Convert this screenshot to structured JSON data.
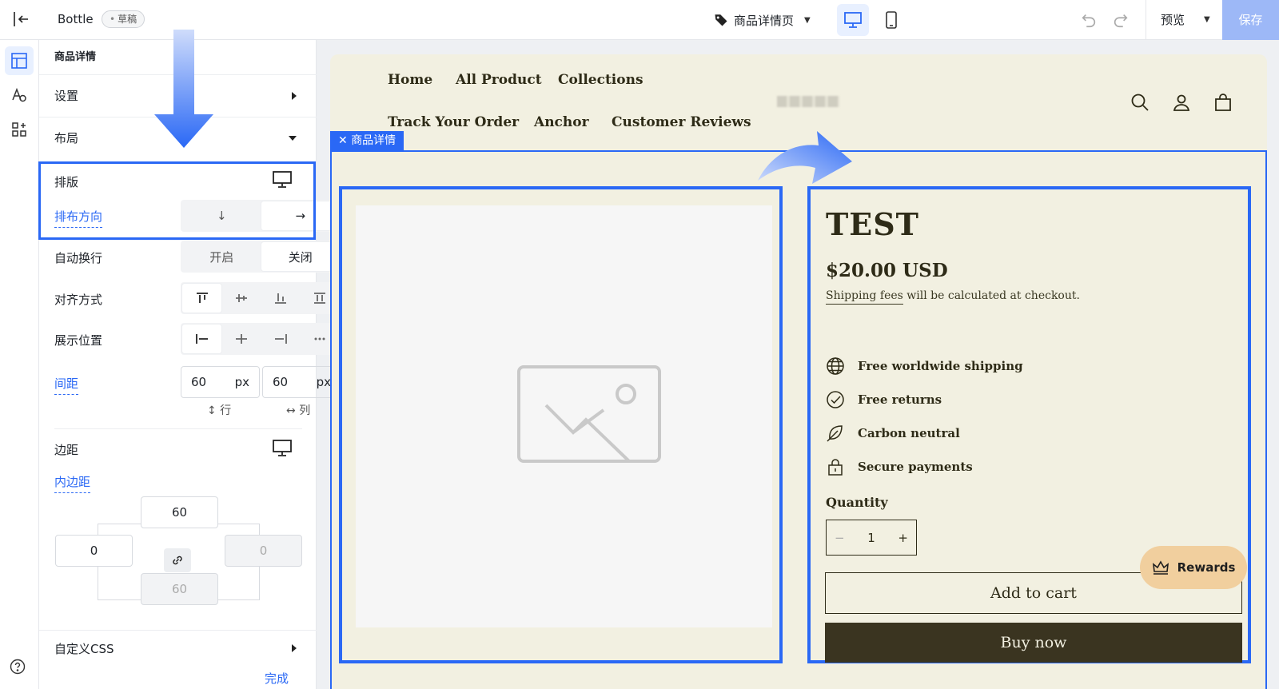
{
  "topbar": {
    "app_title": "Bottle",
    "draft_badge": "草稿",
    "page_selector": "商品详情页",
    "preview_label": "预览",
    "save_label": "保存"
  },
  "panel": {
    "title": "商品详情",
    "settings_label": "设置",
    "layout_label": "布局",
    "typesetting_label": "排版",
    "direction_label": "排布方向",
    "direction_options": [
      "↓",
      "→"
    ],
    "wrap_label": "自动换行",
    "wrap_options": [
      "开启",
      "关闭"
    ],
    "align_label": "对齐方式",
    "position_label": "展示位置",
    "gap_label": "间距",
    "gap_row_value": "60",
    "gap_col_value": "60",
    "unit": "px",
    "row_label": "行",
    "col_label": "列",
    "margin_label": "边距",
    "padding_label": "内边距",
    "padding_top": "60",
    "padding_left": "0",
    "padding_right": "0",
    "padding_bottom": "60",
    "custom_css_label": "自定义CSS",
    "done_label": "完成"
  },
  "store": {
    "nav_row1": [
      "Home",
      "All Product",
      "Collections"
    ],
    "nav_row2": [
      "Track Your Order",
      "Anchor",
      "Customer Reviews"
    ],
    "section_tag": "商品详情",
    "product_title": "TEST",
    "price": "$20.00 USD",
    "shipping_link": "Shipping fees",
    "shipping_rest": " will be calculated at checkout.",
    "features": [
      "Free worldwide shipping",
      "Free returns",
      "Carbon neutral",
      "Secure payments"
    ],
    "quantity_label": "Quantity",
    "quantity_value": "1",
    "add_to_cart": "Add to cart",
    "buy_now": "Buy now",
    "rewards": "Rewards"
  },
  "colors": {
    "accent": "#2a68f5",
    "canvas_bg": "#f2f0e1",
    "buy_btn": "#3a3420",
    "rewards_bg": "#f1cf9e"
  }
}
